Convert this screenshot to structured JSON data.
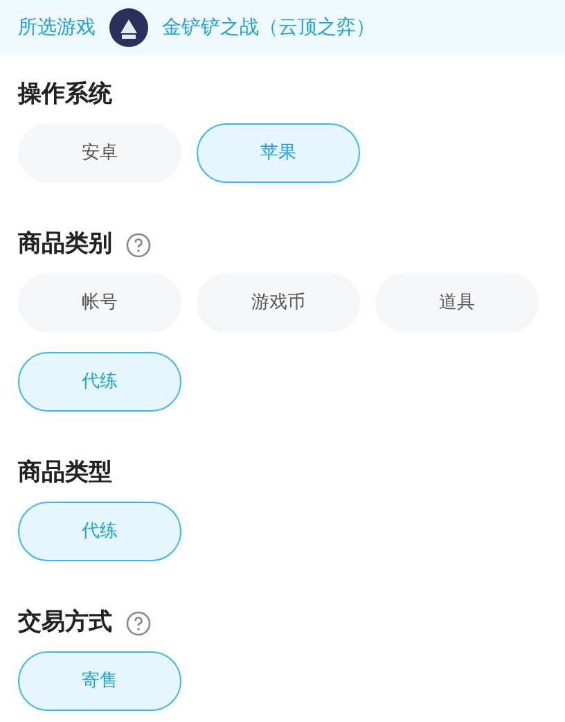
{
  "header": {
    "label": "所选游戏",
    "game": "金铲铲之战（云顶之弈）"
  },
  "sections": [
    {
      "title": "操作系统",
      "help": false,
      "options": [
        {
          "label": "安卓",
          "selected": false
        },
        {
          "label": "苹果",
          "selected": true
        }
      ]
    },
    {
      "title": "商品类别",
      "help": true,
      "options": [
        {
          "label": "帐号",
          "selected": false
        },
        {
          "label": "游戏币",
          "selected": false
        },
        {
          "label": "道具",
          "selected": false
        },
        {
          "label": "代练",
          "selected": true
        }
      ]
    },
    {
      "title": "商品类型",
      "help": false,
      "options": [
        {
          "label": "代练",
          "selected": true
        }
      ]
    },
    {
      "title": "交易方式",
      "help": true,
      "options": [
        {
          "label": "寄售",
          "selected": true
        }
      ]
    }
  ]
}
